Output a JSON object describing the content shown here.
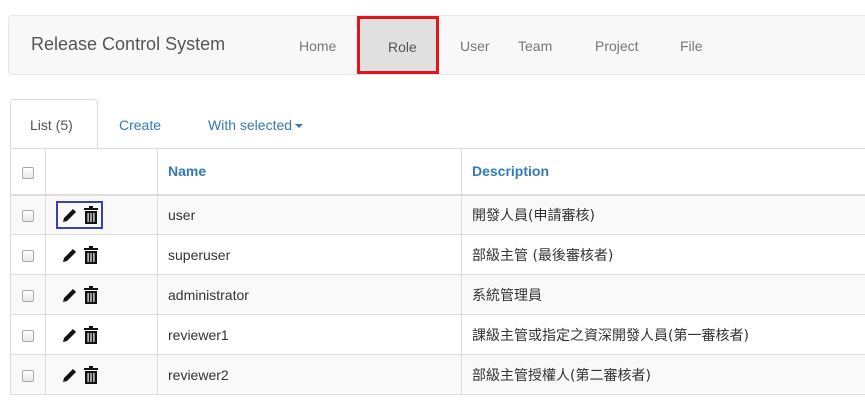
{
  "navbar": {
    "brand": "Release Control System",
    "items": [
      {
        "label": "Home",
        "active": false
      },
      {
        "label": "Role",
        "active": true
      },
      {
        "label": "User",
        "active": false
      },
      {
        "label": "Team",
        "active": false
      },
      {
        "label": "Project",
        "active": false
      },
      {
        "label": "File",
        "active": false
      }
    ]
  },
  "tabs": {
    "list": "List (5)",
    "create": "Create",
    "with_selected": "With selected"
  },
  "table": {
    "columns": [
      "",
      "",
      "Name",
      "Description"
    ],
    "rows": [
      {
        "name": "user",
        "description": "開發人員(申請審核)"
      },
      {
        "name": "superuser",
        "description": "部級主管 (最後審核者)"
      },
      {
        "name": "administrator",
        "description": "系統管理員"
      },
      {
        "name": "reviewer1",
        "description": "課級主管或指定之資深開發人員(第一審核者)"
      },
      {
        "name": "reviewer2",
        "description": "部級主管授權人(第二審核者)"
      }
    ]
  },
  "icons": {
    "edit": "pencil-icon",
    "delete": "trash-icon",
    "dropdown": "caret-down-icon"
  },
  "colors": {
    "link": "#337ab7",
    "active_nav_border": "#e3141a",
    "edit_focus_border": "#3a40b0"
  }
}
